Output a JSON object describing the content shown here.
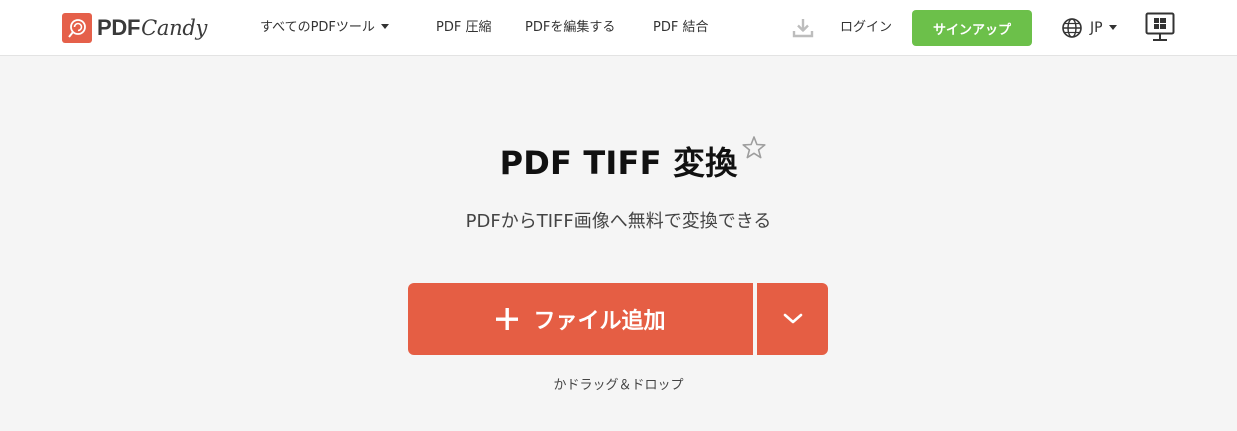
{
  "header": {
    "logo": {
      "brand_bold": "PDF",
      "brand_script": "Candy"
    },
    "nav": [
      {
        "label": "すべてのPDFツール",
        "has_caret": true
      },
      {
        "label": "PDF 圧縮"
      },
      {
        "label": "PDFを編集する"
      },
      {
        "label": "PDF 結合"
      }
    ],
    "download_icon": "download-icon",
    "login_label": "ログイン",
    "signup_label": "サインアップ",
    "language": {
      "label": "JP",
      "icon": "globe-icon"
    },
    "desktop_icon": "windows-desktop-icon"
  },
  "main": {
    "title": "PDF TIFF 変換",
    "favorite_icon": "star-outline-icon",
    "subtitle": "PDFからTIFF画像へ無料で変換できる",
    "add_file_label": "ファイル追加",
    "drag_drop_hint": "かドラッグ＆ドロップ"
  },
  "colors": {
    "brand_orange": "#e55e44",
    "signup_green": "#6cc04a",
    "background": "#f5f5f5",
    "header_bg": "#ffffff"
  }
}
